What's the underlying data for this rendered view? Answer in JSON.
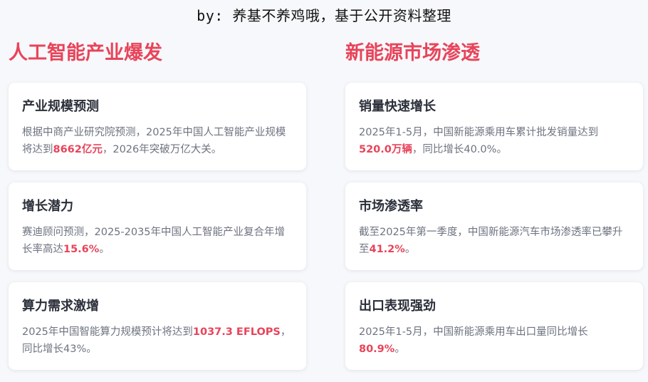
{
  "byline": "by: 养基不养鸡哦，基于公开资料整理",
  "left": {
    "title": "人工智能产业爆发",
    "cards": [
      {
        "title": "产业规模预测",
        "pre": "根据中商产业研究院预测，2025年中国人工智能产业规模将达到",
        "highlight": "8662亿元",
        "post": "，2026年突破万亿大关。"
      },
      {
        "title": "增长潜力",
        "pre": "赛迪顾问预测，2025-2035年中国人工智能产业复合年增长率高达",
        "highlight": "15.6%",
        "post": "。"
      },
      {
        "title": "算力需求激增",
        "pre": "2025年中国智能算力规模预计将达到",
        "highlight": "1037.3 EFLOPS",
        "post": "，同比增长43%。"
      }
    ]
  },
  "right": {
    "title": "新能源市场渗透",
    "cards": [
      {
        "title": "销量快速增长",
        "pre": "2025年1-5月，中国新能源乘用车累计批发销量达到",
        "highlight": "520.0万辆",
        "post": "，同比增长40.0%。"
      },
      {
        "title": "市场渗透率",
        "pre": "截至2025年第一季度，中国新能源汽车市场渗透率已攀升至",
        "highlight": "41.2%",
        "post": "。"
      },
      {
        "title": "出口表现强劲",
        "pre": "2025年1-5月，中国新能源乘用车出口量同比增长",
        "highlight": "80.9%",
        "post": "。"
      }
    ]
  },
  "colors": {
    "accent": "#e8445a",
    "background": "#f7f8fb",
    "card": "#ffffff",
    "card_title": "#2b2f3a",
    "body_text": "#6e7380"
  }
}
